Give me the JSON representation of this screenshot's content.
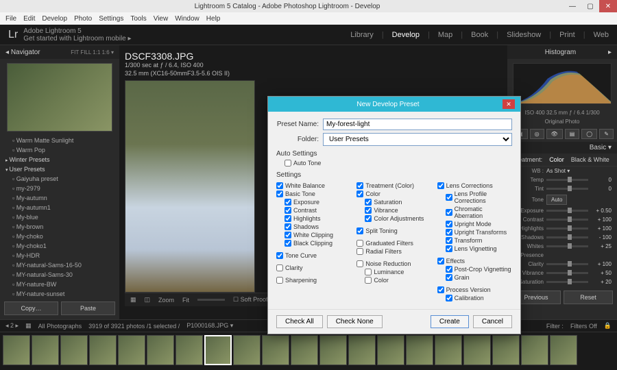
{
  "title": "Lightroom 5 Catalog - Adobe Photoshop Lightroom - Develop",
  "menubar": [
    "File",
    "Edit",
    "Develop",
    "Photo",
    "Settings",
    "Tools",
    "View",
    "Window",
    "Help"
  ],
  "id_line1": "Adobe Lightroom 5",
  "id_line2": "Get started with Lightroom mobile  ▸",
  "modules": [
    "Library",
    "Develop",
    "Map",
    "Book",
    "Slideshow",
    "Print",
    "Web"
  ],
  "module_active": "Develop",
  "navigator": {
    "title": "Navigator",
    "opts": [
      "FIT",
      "FILL",
      "1:1",
      "1:6 ▾"
    ]
  },
  "image": {
    "filename": "DSCF3308.JPG",
    "meta1": "1/300 sec at ƒ / 6.4, ISO 400",
    "meta2": "32.5 mm (XC16-50mmF3.5-5.6 OIS II)"
  },
  "presets": {
    "items": [
      "Warm Matte Sunlight",
      "Warm Pop"
    ],
    "folders": [
      "Winter Presets",
      "User Presets"
    ],
    "user": [
      "Gaiyuha preset",
      "my-2979",
      "My-autumn",
      "My-autumn1",
      "My-blue",
      "My-brown",
      "My-choko",
      "My-choko1",
      "My-HDR",
      "MY-natural-Sams-16-50",
      "MY-natural-Sams-30",
      "MY-nature-BW",
      "MY-nature-sunset"
    ]
  },
  "btns": {
    "copy": "Copy…",
    "paste": "Paste"
  },
  "toolbar": {
    "zoom": "Zoom",
    "fit": "Fit",
    "soft": "Soft Proofing"
  },
  "right": {
    "histogram": "Histogram",
    "histinfo": "ISO 400   32.5 mm   ƒ / 6.4   1/300",
    "origphoto": "Original Photo",
    "basic": "Basic ▾",
    "treat": [
      "Color",
      "Black & White"
    ],
    "wb": "WB :",
    "wbval": "As Shot ▾",
    "tone": "Tone",
    "auto": "Auto",
    "sliders": [
      {
        "n": "Exposure",
        "v": "+ 0.50"
      },
      {
        "n": "Contrast",
        "v": "+ 100"
      },
      {
        "n": "Highlights",
        "v": "+ 100"
      },
      {
        "n": "Shadows",
        "v": "- 100"
      },
      {
        "n": "Whites",
        "v": "+ 25"
      }
    ],
    "presence": "Presence",
    "psliders": [
      {
        "n": "Clarity",
        "v": "+ 100"
      },
      {
        "n": "Vibrance",
        "v": "+ 50"
      },
      {
        "n": "Saturation",
        "v": "+ 20"
      }
    ],
    "prev": "Previous",
    "reset": "Reset"
  },
  "dialog": {
    "title": "New Develop Preset",
    "name_lbl": "Preset Name:",
    "name": "My-forest-light",
    "folder_lbl": "Folder:",
    "folder": "User Presets",
    "auto_head": "Auto Settings",
    "auto_tone": "Auto Tone",
    "settings_head": "Settings",
    "col1": [
      {
        "l": "White Balance",
        "c": true
      },
      {
        "l": "Basic Tone",
        "c": true
      },
      {
        "l": "Exposure",
        "c": true,
        "i": true
      },
      {
        "l": "Contrast",
        "c": true,
        "i": true
      },
      {
        "l": "Highlights",
        "c": true,
        "i": true
      },
      {
        "l": "Shadows",
        "c": true,
        "i": true
      },
      {
        "l": "White Clipping",
        "c": true,
        "i": true
      },
      {
        "l": "Black Clipping",
        "c": true,
        "i": true
      },
      {
        "l": "Tone Curve",
        "c": true,
        "sp": true
      },
      {
        "l": "Clarity",
        "c": false,
        "sp": true
      },
      {
        "l": "Sharpening",
        "c": false,
        "sp": true
      }
    ],
    "col2": [
      {
        "l": "Treatment (Color)",
        "c": true
      },
      {
        "l": "Color",
        "c": true
      },
      {
        "l": "Saturation",
        "c": true,
        "i": true
      },
      {
        "l": "Vibrance",
        "c": true,
        "i": true
      },
      {
        "l": "Color Adjustments",
        "c": true,
        "i": true
      },
      {
        "l": "Split Toning",
        "c": true,
        "sp": true
      },
      {
        "l": "Graduated Filters",
        "c": false,
        "sp": true
      },
      {
        "l": "Radial Filters",
        "c": false
      },
      {
        "l": "Noise Reduction",
        "c": false,
        "sp": true
      },
      {
        "l": "Luminance",
        "c": false,
        "i": true
      },
      {
        "l": "Color",
        "c": false,
        "i": true
      }
    ],
    "col3": [
      {
        "l": "Lens Corrections",
        "c": true
      },
      {
        "l": "Lens Profile Corrections",
        "c": true,
        "i": true
      },
      {
        "l": "Chromatic Aberration",
        "c": true,
        "i": true
      },
      {
        "l": "Upright Mode",
        "c": true,
        "i": true
      },
      {
        "l": "Upright Transforms",
        "c": true,
        "i": true
      },
      {
        "l": "Transform",
        "c": true,
        "i": true
      },
      {
        "l": "Lens Vignetting",
        "c": true,
        "i": true
      },
      {
        "l": "Effects",
        "c": true,
        "sp": true
      },
      {
        "l": "Post-Crop Vignetting",
        "c": true,
        "i": true
      },
      {
        "l": "Grain",
        "c": true,
        "i": true
      },
      {
        "l": "Process Version",
        "c": true,
        "sp": true
      },
      {
        "l": "Calibration",
        "c": true,
        "i": true
      }
    ],
    "check_all": "Check All",
    "check_none": "Check None",
    "create": "Create",
    "cancel": "Cancel"
  },
  "status": {
    "pages": "2",
    "all": "All Photographs",
    "count": "3919 of 3921 photos /1 selected /",
    "file": "P1000168.JPG ▾",
    "filter": "Filter :",
    "filters_off": "Filters Off"
  }
}
